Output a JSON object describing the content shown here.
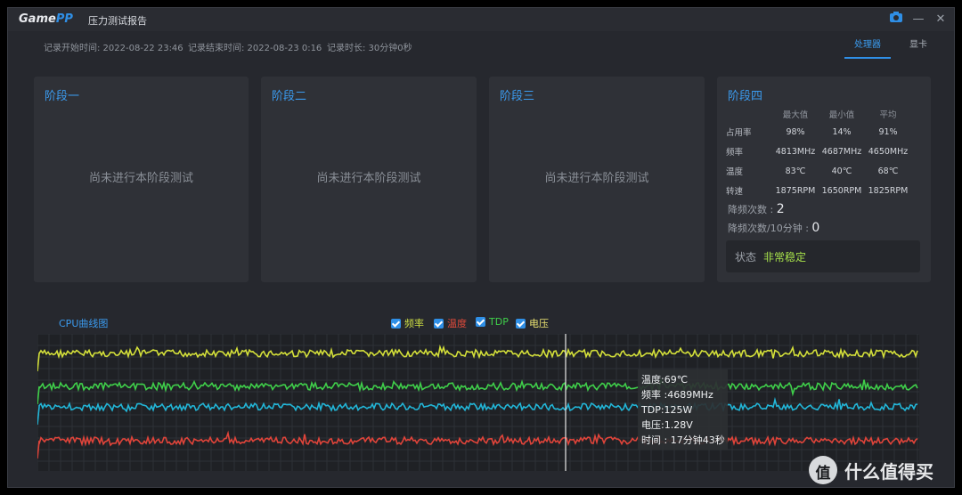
{
  "app": {
    "logo_game": "Game",
    "logo_pp": "PP",
    "window_title": "压力测试报告"
  },
  "titlebar_icons": {
    "camera": "camera-icon",
    "minimize": "minimize-icon",
    "close": "close-icon"
  },
  "meta": {
    "start": "记录开始时间: 2022-08-22 23:46",
    "end": "记录结束时间: 2022-08-23 0:16",
    "duration": "记录时长: 30分钟0秒"
  },
  "tabs": [
    {
      "label": "处理器",
      "active": true
    },
    {
      "label": "显卡",
      "active": false
    }
  ],
  "stages": [
    {
      "title": "阶段一",
      "message": "尚未进行本阶段测试"
    },
    {
      "title": "阶段二",
      "message": "尚未进行本阶段测试"
    },
    {
      "title": "阶段三",
      "message": "尚未进行本阶段测试"
    }
  ],
  "stage4": {
    "title": "阶段四",
    "headers": [
      "最大值",
      "最小值",
      "平均"
    ],
    "rows": [
      {
        "label": "占用率",
        "values": [
          "98%",
          "14%",
          "91%"
        ]
      },
      {
        "label": "频率",
        "values": [
          "4813MHz",
          "4687MHz",
          "4650MHz"
        ]
      },
      {
        "label": "温度",
        "values": [
          "83℃",
          "40℃",
          "68℃"
        ]
      },
      {
        "label": "转速",
        "values": [
          "1875RPM",
          "1650RPM",
          "1825RPM"
        ]
      }
    ],
    "throttle_label": "降频次数 :",
    "throttle_value": "2",
    "throttle10_label": "降频次数/10分钟 :",
    "throttle10_value": "0",
    "status_label": "状态",
    "status_value": "非常稳定"
  },
  "chart": {
    "title": "CPU曲线图",
    "legend": [
      {
        "label": "频率",
        "color": "#ccdd44"
      },
      {
        "label": "温度",
        "color": "#e04a3a"
      },
      {
        "label": "TDP",
        "color": "#3fcf4a"
      },
      {
        "label": "电压",
        "color": "#e8e070"
      }
    ],
    "series_colors": {
      "yellow": "#d4e03a",
      "green": "#3fcf4a",
      "cyan": "#22b6d8",
      "red": "#e0443a"
    },
    "tooltip": {
      "temp": "温度:69℃",
      "freq": "频率 :4689MHz",
      "tdp": "TDP:125W",
      "volt": "电压:1.28V",
      "time": "时间 : 17分钟43秒"
    }
  },
  "watermark": {
    "glyph": "值",
    "text": "什么值得买"
  }
}
